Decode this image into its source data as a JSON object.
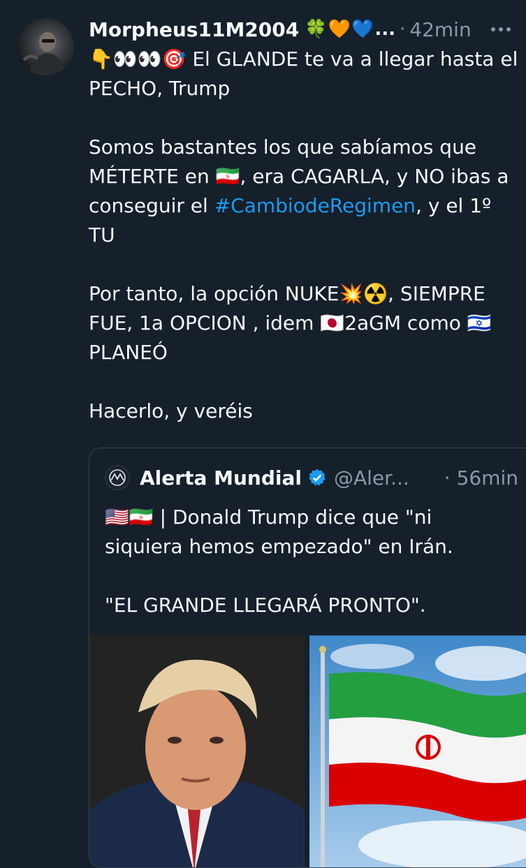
{
  "tweet": {
    "author_name": "Morpheus11M2004",
    "author_emojis": "🍀🧡💙",
    "ellipsis": "...",
    "separator": "·",
    "time": "42min",
    "line1": "👇👀👀🎯 El GLANDE te va a llegar hasta el PECHO, Trump",
    "p2_before": "Somos bastantes los que sabíamos que MÉTERTE en 🇮🇷, era CAGARLA, y NO ibas a conseguir el ",
    "p2_hashtag": "#CambiodeRegimen",
    "p2_after": ", y el 1º TU",
    "p3": "Por tanto, la opción NUKE💥☢️, SIEMPRE FUE, 1a OPCION , idem 🇯🇵2aGM como 🇮🇱 PLANEÓ",
    "p4": "Hacerlo, y veréis"
  },
  "quote": {
    "name": "Alerta Mundial",
    "handle": "@Aler...",
    "separator": "·",
    "time": "56min",
    "line1": "🇺🇸🇮🇷 | Donald Trump dice que \"ni siquiera hemos empezado\" en Irán.",
    "line2": "\"EL GRANDE LLEGARÁ PRONTO\".",
    "images": [
      "portrait-photo",
      "iran-flag-photo"
    ]
  },
  "colors": {
    "background": "#15202b",
    "text": "#f7f9f9",
    "muted": "#8b98a5",
    "link": "#1d9bf0",
    "border": "#38444d"
  }
}
